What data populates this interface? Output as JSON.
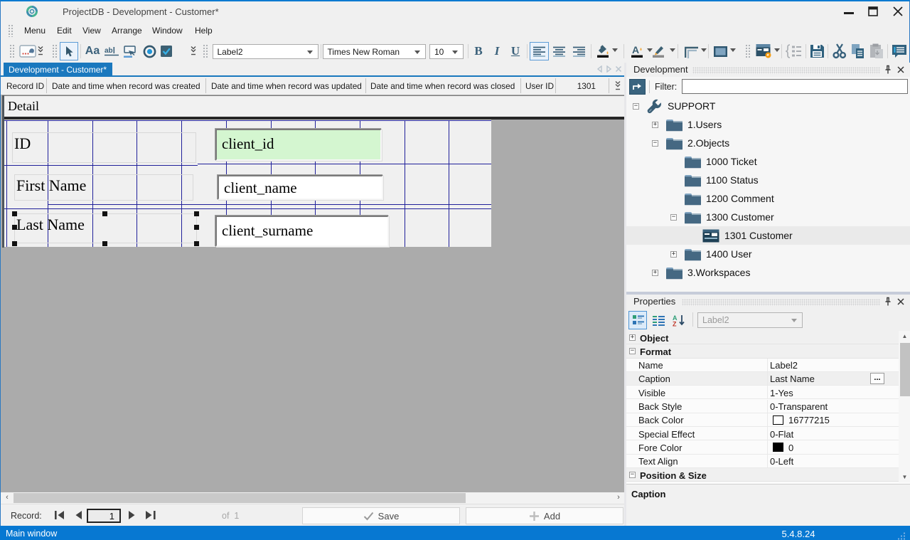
{
  "window": {
    "title": "ProjectDB - Development - Customer*",
    "status_left": "Main window",
    "status_right": "5.4.8.24",
    "accent_color": "#1a78be",
    "status_color": "#0778d2"
  },
  "menu": {
    "items": [
      "Menu",
      "Edit",
      "View",
      "Arrange",
      "Window",
      "Help"
    ]
  },
  "toolbar": {
    "style_combo": "Label2",
    "font_combo": "Times New Roman",
    "size_combo": "10",
    "bold": "B",
    "italic": "I",
    "underline": "U",
    "label_tool": "Aa",
    "textbox_tool": "abl"
  },
  "tabs": {
    "active_tab": "Development - Customer*"
  },
  "record_header": {
    "cells": [
      "Record ID",
      "Date and time when record was created",
      "Date and time when record was updated",
      "Date and time when record was closed",
      "User ID",
      "1301"
    ]
  },
  "designer": {
    "band": "Detail",
    "fields": [
      {
        "label": "ID",
        "value": "client_id",
        "value_bg": "#d4f6d0"
      },
      {
        "label": "First Name",
        "value": "client_name",
        "value_bg": "#ffffff"
      },
      {
        "label": "Last Name",
        "value": "client_surname",
        "value_bg": "#ffffff"
      }
    ]
  },
  "navigator": {
    "label": "Record:",
    "current": "1",
    "of": "of  1",
    "save": "Save",
    "add": "Add"
  },
  "dev_panel": {
    "title": "Development",
    "filter_label": "Filter:",
    "filter_value": "",
    "tree": [
      {
        "label": "SUPPORT",
        "icon": "wrench-icon",
        "expander": "-"
      },
      {
        "label": "1.Users",
        "icon": "folder-icon",
        "expander": "+"
      },
      {
        "label": "2.Objects",
        "icon": "folder-icon",
        "expander": "-"
      },
      {
        "label": "1000 Ticket",
        "icon": "folder-icon",
        "expander": ""
      },
      {
        "label": "1100 Status",
        "icon": "folder-icon",
        "expander": ""
      },
      {
        "label": "1200 Comment",
        "icon": "folder-icon",
        "expander": ""
      },
      {
        "label": "1300 Customer",
        "icon": "folder-icon",
        "expander": "-"
      },
      {
        "label": "1301 Customer",
        "icon": "form-icon",
        "expander": "",
        "selected": true
      },
      {
        "label": "1400 User",
        "icon": "folder-icon",
        "expander": "+"
      },
      {
        "label": "3.Workspaces",
        "icon": "folder-icon",
        "expander": "+"
      }
    ]
  },
  "props_panel": {
    "title": "Properties",
    "selector": "Label2",
    "categories": {
      "object": "Object",
      "format": "Format",
      "possize": "Position & Size"
    },
    "rows": [
      {
        "name": "Name",
        "value": "Label2"
      },
      {
        "name": "Caption",
        "value": "Last Name",
        "editor": "..."
      },
      {
        "name": "Visible",
        "value": "1-Yes"
      },
      {
        "name": "Back Style",
        "value": "0-Transparent"
      },
      {
        "name": "Back Color",
        "value": "16777215",
        "swatch": "#ffffff"
      },
      {
        "name": "Special Effect",
        "value": "0-Flat"
      },
      {
        "name": "Fore Color",
        "value": "0",
        "swatch": "#000000"
      },
      {
        "name": "Text Align",
        "value": "0-Left"
      }
    ],
    "description": "Caption"
  },
  "icons": {
    "app-logo-icon": "teal swirl",
    "minimize-icon": "−",
    "maximize-icon": "□",
    "close-icon": "✕",
    "pointer-icon": "cursor arrow",
    "label-icon": "Aa",
    "textbox-icon": "abl",
    "button-icon": "button",
    "radio-icon": "radio",
    "checkbox-icon": "check",
    "align-left-icon": "lines",
    "align-center-icon": "lines",
    "align-right-icon": "lines",
    "fill-color-icon": "bucket",
    "font-color-icon": "A",
    "line-color-icon": "marker",
    "border-icon": "corner",
    "rectangle-icon": "rect",
    "form-icon": "window",
    "fields-list-icon": "braces",
    "save-icon": "floppy",
    "cut-icon": "scissors",
    "copy-icon": "pages",
    "paste-icon": "clipboard",
    "comment-icon": "bubble",
    "pin-icon": "pushpin",
    "goto-icon": "arrow",
    "wrench-icon": "wrench",
    "folder-icon": "folder",
    "check-icon": "✓",
    "plus-icon": "+"
  }
}
